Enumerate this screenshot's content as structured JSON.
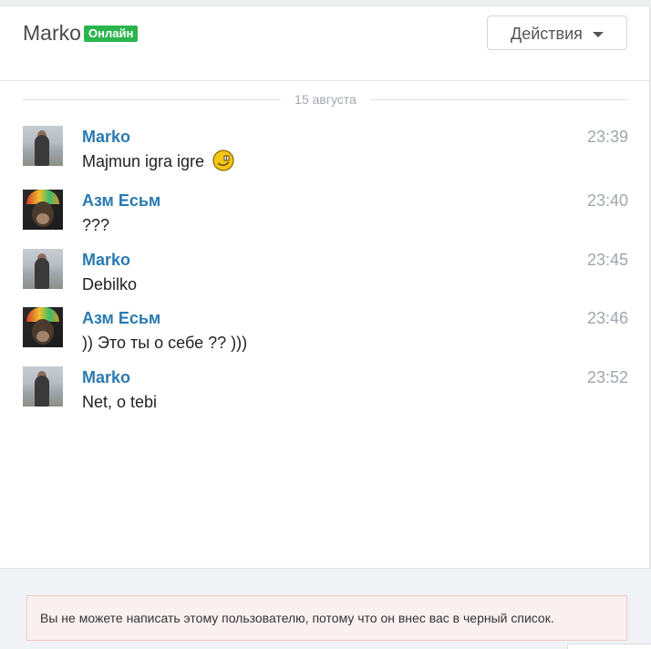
{
  "header": {
    "name": "Marko",
    "status_badge": "Онлайн",
    "actions_label": "Действия"
  },
  "date_separator": "15 августа",
  "messages": [
    {
      "sender": "Marko",
      "time": "23:39",
      "text": "Majmun igra igre",
      "avatar": "marko-avatar",
      "has_smiley": true
    },
    {
      "sender": "Азм Есьм",
      "time": "23:40",
      "text": "???",
      "avatar": "azm-avatar"
    },
    {
      "sender": "Marko",
      "time": "23:45",
      "text": "Debilko",
      "avatar": "marko-avatar"
    },
    {
      "sender": "Азм Есьм",
      "time": "23:46",
      "text": ")) Это ты о себе ?? )))",
      "avatar": "azm-avatar"
    },
    {
      "sender": "Marko",
      "time": "23:52",
      "text": "Net, o tebi",
      "avatar": "marko-avatar"
    }
  ],
  "footer": {
    "blocked_notice": "Вы не можете написать этому пользователю, потому что он внес вас в черный список."
  },
  "colors": {
    "online_badge": "#2ab44e",
    "sender_link": "#2a7ab0",
    "time": "#a0a6ad",
    "notice_bg": "#fbf0f0",
    "notice_border": "#f2c9c9"
  },
  "icons": {
    "dropdown": "chevron-down-icon",
    "emoji": "smiley-icon"
  }
}
